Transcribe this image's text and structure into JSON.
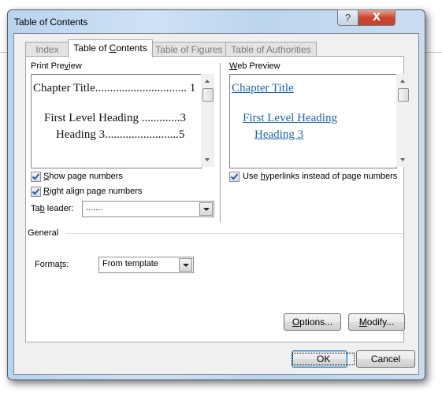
{
  "window": {
    "title": "Table of Contents",
    "help_label": "?",
    "close_label": "X"
  },
  "tabs": [
    {
      "label": "Index",
      "active": false
    },
    {
      "label_pre": "Table of ",
      "label_ul": "C",
      "label_post": "ontents",
      "active": true
    },
    {
      "label": "Table of Figures",
      "active": false
    },
    {
      "label": "Table of Authorities",
      "active": false
    }
  ],
  "print_preview": {
    "label_pre": "Print Pre",
    "label_ul": "v",
    "label_post": "iew",
    "entries": [
      {
        "text": "Chapter Title",
        "leader": "...............................",
        "page": "1"
      },
      {
        "text": "First Level Heading",
        "leader": ".............",
        "page": "3"
      },
      {
        "text": "Heading 3",
        "leader": ".........................",
        "page": "5"
      }
    ]
  },
  "web_preview": {
    "label_ul": "W",
    "label_post": "eb Preview",
    "entries": [
      {
        "text": "Chapter Title"
      },
      {
        "text": "First Level Heading"
      },
      {
        "text": "Heading 3"
      }
    ]
  },
  "options": {
    "show_page_numbers": {
      "ul": "S",
      "rest": "how page numbers",
      "checked": true
    },
    "right_align": {
      "ul": "R",
      "rest": "ight align page numbers",
      "checked": true
    },
    "use_hyperlinks": {
      "pre": "Use ",
      "ul": "h",
      "rest": "yperlinks instead of page numbers",
      "checked": true
    },
    "tab_leader": {
      "label_pre": "Ta",
      "label_ul": "b",
      "label_post": " leader:",
      "value": "......."
    }
  },
  "general": {
    "heading": "General",
    "formats": {
      "label_pre": "Forma",
      "label_ul": "t",
      "label_post": "s:",
      "value": "From template"
    }
  },
  "buttons": {
    "options": {
      "ul": "O",
      "rest": "ptions..."
    },
    "modify": {
      "ul": "M",
      "rest": "odify..."
    },
    "ok": "OK",
    "cancel": "Cancel"
  }
}
